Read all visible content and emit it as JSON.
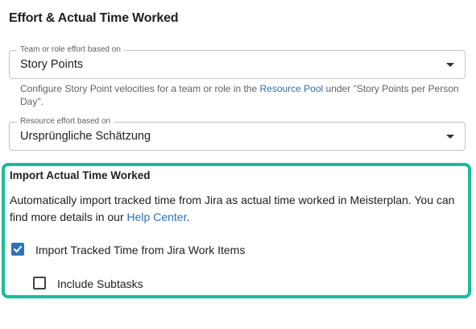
{
  "section_title": "Effort & Actual Time Worked",
  "team_effort": {
    "legend": "Team or role effort based on",
    "value": "Story Points"
  },
  "helper": {
    "text_before": "Configure Story Point velocities for a team or role in the ",
    "link": "Resource Pool",
    "text_after": " under \"Story Points per Person Day\"."
  },
  "resource_effort": {
    "legend": "Resource effort based on",
    "value": "Ursprüngliche Schätzung"
  },
  "import": {
    "title": "Import Actual Time Worked",
    "desc_before": "Automatically import tracked time from Jira as actual time worked in Meisterplan. You can find more details in our ",
    "desc_link": "Help Center",
    "desc_after": ".",
    "import_tracked_label": "Import Tracked Time from Jira Work Items",
    "import_tracked_checked": true,
    "include_subtasks_label": "Include Subtasks",
    "include_subtasks_checked": false
  },
  "colors": {
    "highlight": "#1abc9c",
    "link": "#2f6fb0",
    "checkbox": "#2f72b6"
  },
  "icons": [
    "chevron-down-icon",
    "checkmark-icon"
  ]
}
